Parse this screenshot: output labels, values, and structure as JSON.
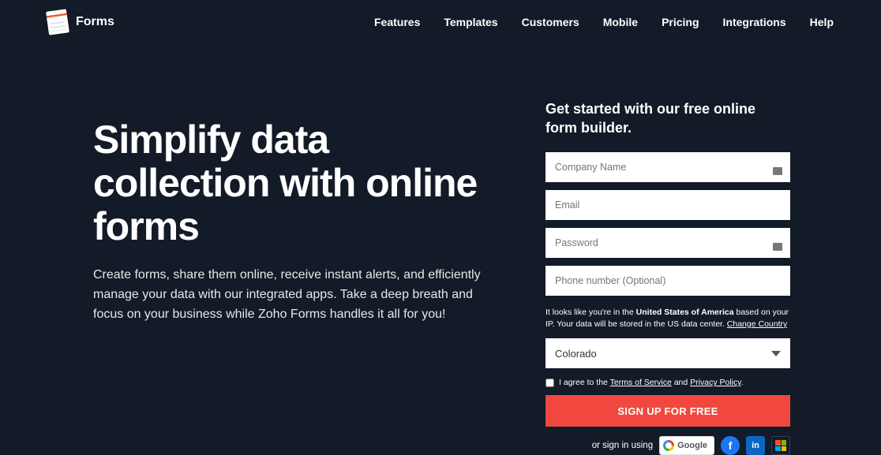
{
  "brand": {
    "name": "Forms"
  },
  "nav": {
    "features": "Features",
    "templates": "Templates",
    "customers": "Customers",
    "mobile": "Mobile",
    "pricing": "Pricing",
    "integrations": "Integrations",
    "help": "Help"
  },
  "hero": {
    "title": "Simplify data collection with online forms",
    "subtitle": "Create forms, share them online, receive instant alerts, and efficiently manage your data with our integrated apps. Take a deep breath and focus on your business while Zoho Forms handles it all for you!"
  },
  "form": {
    "heading": "Get started with our free online form builder.",
    "company_placeholder": "Company Name",
    "email_placeholder": "Email",
    "password_placeholder": "Password",
    "phone_placeholder": "Phone number (Optional)",
    "notice_prefix": "It looks like you're in the ",
    "notice_country": "United States of America",
    "notice_suffix": " based on your IP. Your data will be stored in the US data center. ",
    "change_country": "Change Country",
    "state_selected": "Colorado",
    "agree_prefix": "I agree to the ",
    "tos": "Terms of Service",
    "agree_mid": " and ",
    "privacy": "Privacy Policy",
    "agree_suffix": ".",
    "submit": "SIGN UP FOR FREE",
    "social_prefix": "or sign in using",
    "google_label": "Google"
  }
}
